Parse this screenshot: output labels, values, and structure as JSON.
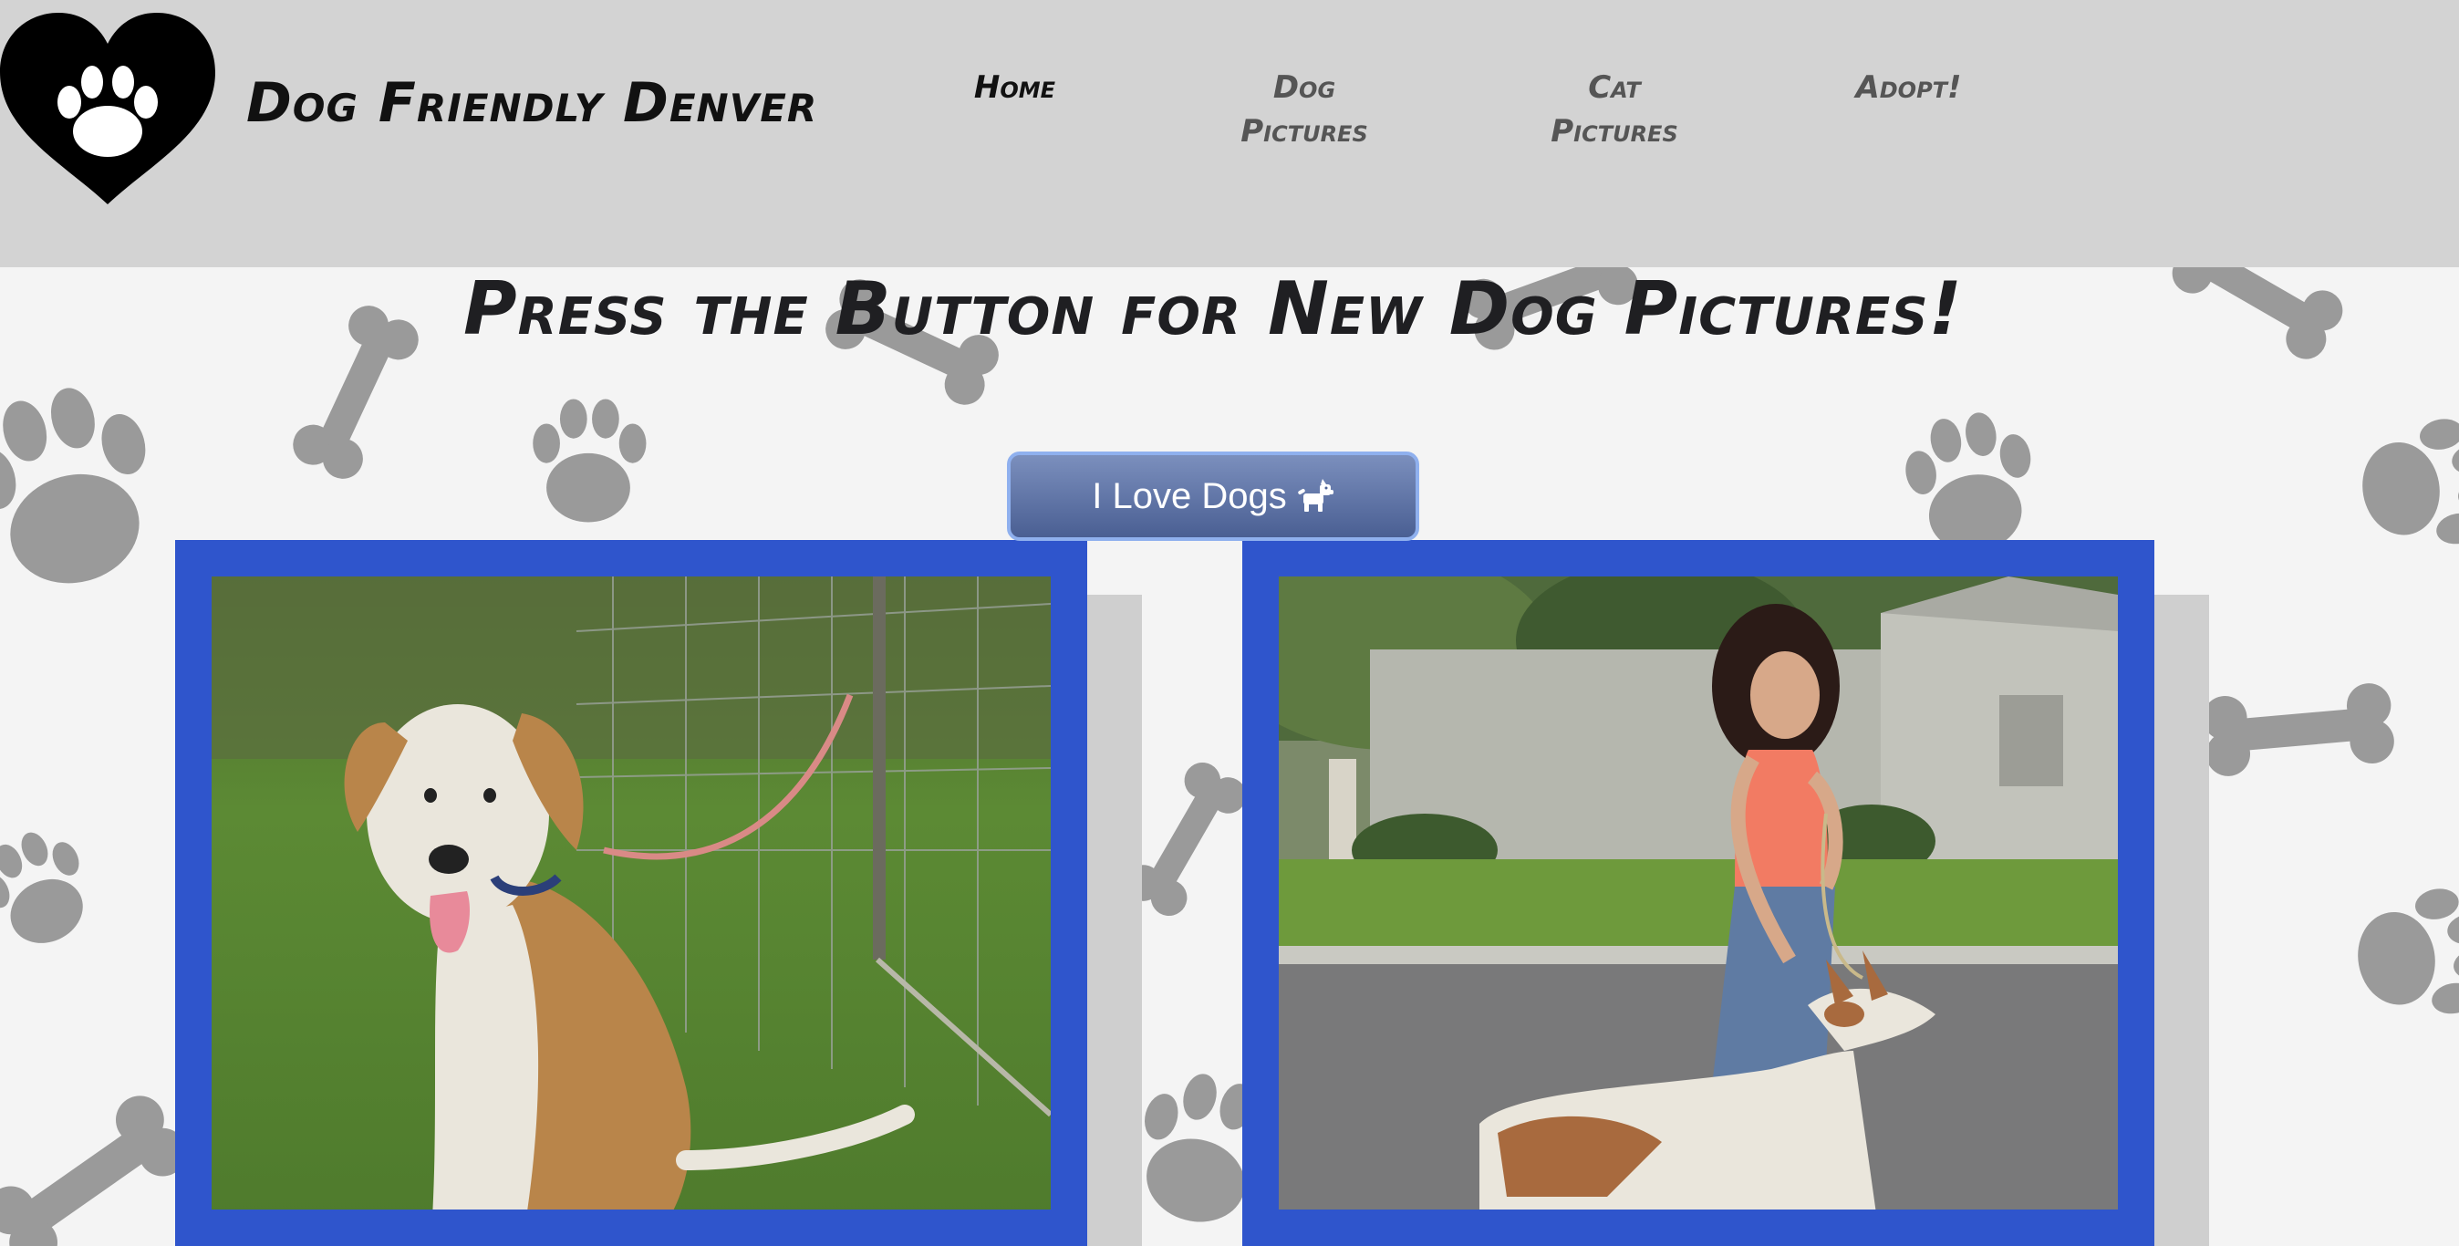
{
  "header": {
    "logo_icon": "paw-heart-icon",
    "site_title": "Dog Friendly Denver",
    "background_color": "#d3d3d3"
  },
  "nav": {
    "items": [
      {
        "label_line1": "Home",
        "label_line2": "",
        "active": true
      },
      {
        "label_line1": "Dog",
        "label_line2": "Pictures",
        "active": false
      },
      {
        "label_line1": "Cat",
        "label_line2": "Pictures",
        "active": false
      },
      {
        "label_line1": "Adopt!",
        "label_line2": "",
        "active": false
      }
    ]
  },
  "main": {
    "heading": "Press the Button for New Dog Pictures!",
    "button": {
      "label": "I Love Dogs",
      "icon": "dog-icon"
    },
    "photos": [
      {
        "name": "dog-photo-hound",
        "description_icon": "photo-icon"
      },
      {
        "name": "dog-photo-woman-walking-dog",
        "description_icon": "photo-icon"
      }
    ]
  },
  "colors": {
    "card_border": "#2f55cc",
    "button_top": "#7b8fbd",
    "button_bottom": "#4a5f93",
    "page_background": "#f4f4f4",
    "pattern": "#9a9a9a"
  }
}
